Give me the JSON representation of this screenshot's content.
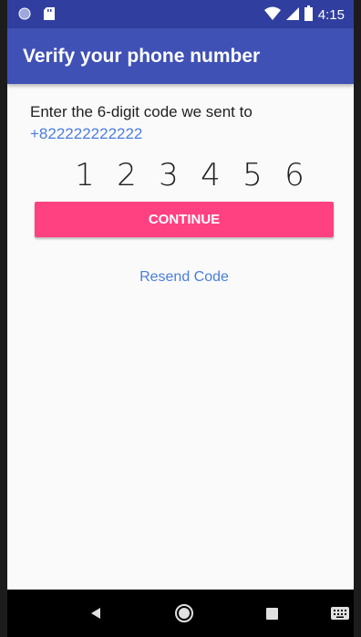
{
  "status_bar": {
    "time": "4:15",
    "icons": [
      "sync-circle-icon",
      "sd-card-icon",
      "wifi-icon",
      "signal-icon",
      "battery-icon"
    ]
  },
  "app_bar": {
    "title": "Verify your phone number"
  },
  "verification": {
    "prompt": "Enter the 6-digit code we sent to",
    "phone_number": "+822222222222",
    "code_digits": [
      "1",
      "2",
      "3",
      "4",
      "5",
      "6"
    ]
  },
  "actions": {
    "continue_label": "CONTINUE",
    "resend_label": "Resend Code"
  },
  "nav_bar": {
    "icons": [
      "back-icon",
      "home-icon",
      "recents-icon",
      "keyboard-icon"
    ]
  },
  "colors": {
    "status_bar": "#303f9f",
    "app_bar": "#3f51b5",
    "accent": "#ff4081",
    "link": "#4a7de0"
  }
}
